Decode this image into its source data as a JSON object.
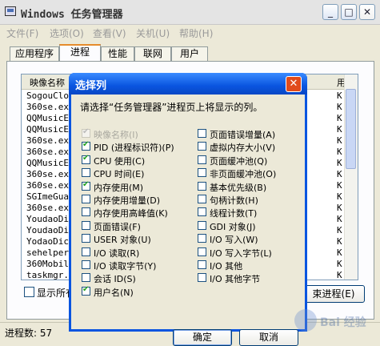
{
  "window": {
    "title": "Windows 任务管理器"
  },
  "menu": [
    "文件(F)",
    "选项(O)",
    "查看(V)",
    "关机(U)",
    "帮助(H)"
  ],
  "tabs": [
    "应用程序",
    "进程",
    "性能",
    "联网",
    "用户"
  ],
  "active_tab": "进程",
  "listview": {
    "col1": "映像名称",
    "col2": "用",
    "rows": [
      "SogouClou",
      "360se.exe",
      "QQMusicEx",
      "QQMusicEx",
      "360se.exe",
      "360se.exe",
      "QQMusicEx",
      "360se.exe",
      "360se.exe",
      "SGImeGuar",
      "360se.exe",
      "YoudaoDic",
      "YoudaoDic",
      "YodaoDict",
      "sehelper.",
      "360Mobile",
      "taskmgr.e"
    ],
    "row_suffix": "K"
  },
  "show_all_label": "显示所有",
  "end_process_label": "束进程(E)",
  "status": {
    "process_count": "进程数: 57"
  },
  "dialog": {
    "title": "选择列",
    "close_glyph": "✕",
    "description": "请选择“任务管理器”进程页上将显示的列。",
    "left_options": [
      {
        "label": "映像名称(I)",
        "checked": true,
        "disabled": true
      },
      {
        "label": "PID (进程标识符)(P)",
        "checked": true,
        "disabled": false
      },
      {
        "label": "CPU 使用(C)",
        "checked": true,
        "disabled": false
      },
      {
        "label": "CPU 时间(E)",
        "checked": false,
        "disabled": false
      },
      {
        "label": "内存使用(M)",
        "checked": true,
        "disabled": false
      },
      {
        "label": "内存使用增量(D)",
        "checked": false,
        "disabled": false
      },
      {
        "label": "内存使用高峰值(K)",
        "checked": false,
        "disabled": false
      },
      {
        "label": "页面错误(F)",
        "checked": false,
        "disabled": false
      },
      {
        "label": "USER 对象(U)",
        "checked": false,
        "disabled": false
      },
      {
        "label": "I/O 读取(R)",
        "checked": false,
        "disabled": false
      },
      {
        "label": "I/O 读取字节(Y)",
        "checked": false,
        "disabled": false
      },
      {
        "label": "会话 ID(S)",
        "checked": false,
        "disabled": false
      },
      {
        "label": "用户名(N)",
        "checked": true,
        "disabled": false
      }
    ],
    "right_options": [
      {
        "label": "页面错误增量(A)",
        "checked": false
      },
      {
        "label": "虚拟内存大小(V)",
        "checked": false
      },
      {
        "label": "页面缓冲池(Q)",
        "checked": false
      },
      {
        "label": "非页面缓冲池(O)",
        "checked": false
      },
      {
        "label": "基本优先级(B)",
        "checked": false
      },
      {
        "label": "句柄计数(H)",
        "checked": false
      },
      {
        "label": "线程计数(T)",
        "checked": false
      },
      {
        "label": "GDI 对象(J)",
        "checked": false
      },
      {
        "label": "I/O 写入(W)",
        "checked": false
      },
      {
        "label": "I/O 写入字节(L)",
        "checked": false
      },
      {
        "label": "I/O 其他",
        "checked": false
      },
      {
        "label": "I/O 其他字节",
        "checked": false
      }
    ],
    "ok_label": "确定",
    "cancel_label": "取消"
  },
  "watermark_text": "Bai 经验",
  "icons": {
    "app": "task-manager-icon",
    "minimize": "minimize-icon",
    "maximize": "maximize-icon",
    "close": "close-icon"
  }
}
